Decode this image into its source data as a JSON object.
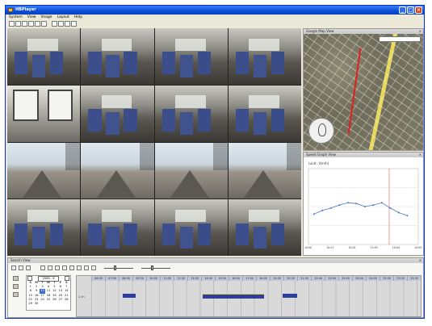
{
  "window": {
    "title": "HBPlayer",
    "app_icon": "app-icon"
  },
  "menu": [
    "System",
    "View",
    "Image",
    "Layout",
    "Help"
  ],
  "toolbar_icons": [
    "layout-1-icon",
    "layout-4-icon",
    "layout-6-icon",
    "layout-9-icon",
    "layout-16-icon",
    "layout-custom-icon",
    "fullscreen-icon",
    "snapshot-icon",
    "export-icon",
    "settings-icon"
  ],
  "cameras": [
    {
      "scene": "bus"
    },
    {
      "scene": "bus"
    },
    {
      "scene": "bus"
    },
    {
      "scene": "bus"
    },
    {
      "scene": "window"
    },
    {
      "scene": "bus"
    },
    {
      "scene": "bus"
    },
    {
      "scene": "bus"
    },
    {
      "scene": "rail"
    },
    {
      "scene": "rail"
    },
    {
      "scene": "rail"
    },
    {
      "scene": "rail"
    },
    {
      "scene": "bus"
    },
    {
      "scene": "bus"
    },
    {
      "scene": "bus"
    },
    {
      "scene": "bus"
    }
  ],
  "map_pane": {
    "title": "Google Map View"
  },
  "speed_pane": {
    "title": "Speed Graph View",
    "unit": "(unit : Km/h)"
  },
  "chart_data": {
    "type": "line",
    "title": "",
    "ylabel": "(unit : Km/h)",
    "x": [
      "10:00",
      "10:01",
      "10:02",
      "10:03",
      "10:04",
      "10:05"
    ],
    "series": [
      {
        "values": [
          40,
          45,
          48,
          52,
          55,
          54,
          50,
          52,
          55,
          48,
          42,
          38
        ]
      }
    ],
    "ylim": [
      0,
      100
    ]
  },
  "search_pane": {
    "title": "Search View"
  },
  "calendar": {
    "month": "2008 - 6",
    "dow": [
      "S",
      "M",
      "T",
      "W",
      "T",
      "F",
      "S"
    ],
    "days": [
      "",
      "",
      "",
      "",
      "",
      "",
      "",
      "1",
      "2",
      "3",
      "4",
      "5",
      "6",
      "7",
      "8",
      "9",
      "10",
      "11",
      "12",
      "13",
      "14",
      "15",
      "16",
      "17",
      "18",
      "19",
      "20",
      "21",
      "22",
      "23",
      "24",
      "25",
      "26",
      "27",
      "28",
      "29",
      "30"
    ],
    "selected": "10"
  },
  "timeline": {
    "hours": [
      "06:00",
      "07:00",
      "08:00",
      "09:00",
      "10:00",
      "11:00",
      "12:00",
      "13:00",
      "14:00",
      "15:00",
      "16:00",
      "17:00",
      "18:00",
      "19:00",
      "20:00",
      "21:00",
      "22:00",
      "23:00",
      "23:00",
      "23:00",
      "23:00",
      "23:00",
      "23:00",
      "23:00"
    ],
    "row_label": "1 ch",
    "segments": [
      {
        "start_hour": 8.3,
        "end_hour": 9.2,
        "highlight": false
      },
      {
        "start_hour": 14.1,
        "end_hour": 18.5,
        "highlight": true
      },
      {
        "start_hour": 19.9,
        "end_hour": 20.9,
        "highlight": false
      }
    ]
  }
}
